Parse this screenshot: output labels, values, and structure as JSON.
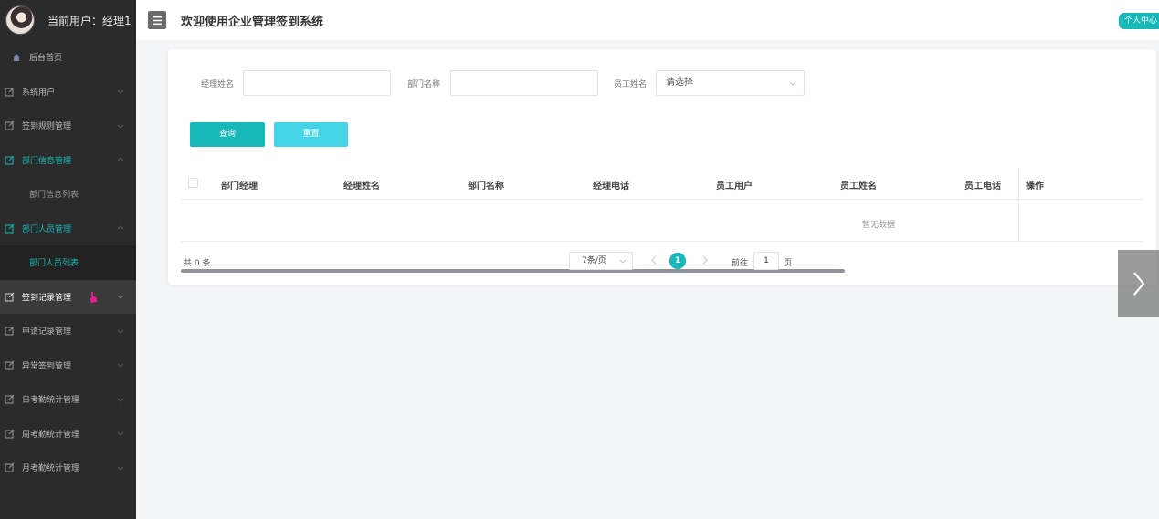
{
  "header": {
    "user_label": "当前用户：经理1",
    "title": "欢迎使用企业管理签到系统",
    "personal_center": "个人中心"
  },
  "sidebar": {
    "home": "后台首页",
    "items": [
      {
        "label": "系统用户"
      },
      {
        "label": "签到规则管理"
      },
      {
        "label": "部门信息管理"
      },
      {
        "label": "部门信息列表"
      },
      {
        "label": "部门人员管理"
      },
      {
        "label": "部门人员列表"
      },
      {
        "label": "签到记录管理"
      },
      {
        "label": "申请记录管理"
      },
      {
        "label": "异常签到管理"
      },
      {
        "label": "日考勤统计管理"
      },
      {
        "label": "周考勤统计管理"
      },
      {
        "label": "月考勤统计管理"
      }
    ]
  },
  "search": {
    "manager_name_label": "经理姓名",
    "manager_name_value": "",
    "dept_name_label": "部门名称",
    "dept_name_value": "",
    "employee_name_label": "员工姓名",
    "employee_name_placeholder": "请选择",
    "query_button": "查询",
    "reset_button": "重置"
  },
  "table": {
    "columns": [
      "部门经理",
      "经理姓名",
      "部门名称",
      "经理电话",
      "员工用户",
      "员工姓名",
      "员工电话",
      "操作"
    ],
    "rows": [],
    "empty_text": "暂无数据"
  },
  "pagination": {
    "total": "共 0 条",
    "page_size": "7条/页",
    "current_page": "1",
    "goto_label": "前往",
    "goto_value": "1",
    "goto_unit": "页"
  },
  "colors": {
    "accent": "#17b8b8",
    "reset_button": "#45d3e6",
    "sidebar_bg": "#2b2b2b"
  }
}
